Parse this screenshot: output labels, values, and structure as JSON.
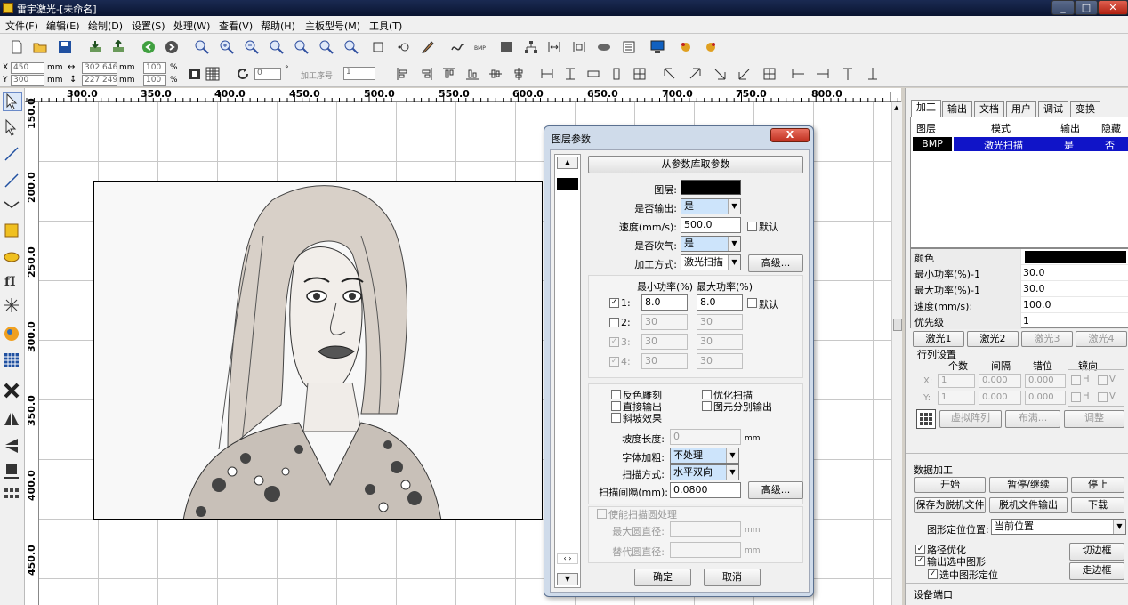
{
  "titlebar": {
    "title": "雷宇激光-[未命名]"
  },
  "menu": [
    "文件(F)",
    "编辑(E)",
    "绘制(D)",
    "设置(S)",
    "处理(W)",
    "查看(V)",
    "帮助(H)",
    "主板型号(M)",
    "工具(T)"
  ],
  "toolbar2": {
    "x_label": "X",
    "x_value": "450",
    "y_label": "Y",
    "y_value": "300",
    "mm": "mm",
    "width_value": "302.646",
    "height_value": "227.249",
    "scale_x": "100",
    "scale_y": "100",
    "percent": "%",
    "rotate_value": "0",
    "degree": "°",
    "order_label": "加工序号:",
    "order_value": "1"
  },
  "ruler": {
    "top_labels": [
      "300.0",
      "350.0",
      "400.0",
      "450.0",
      "500.0",
      "550.0",
      "600.0",
      "650.0",
      "700.0",
      "750.0",
      "800.0"
    ],
    "left_labels": [
      "150.0",
      "200.0",
      "250.0",
      "300.0",
      "350.0",
      "400.0",
      "450.0"
    ]
  },
  "dialog": {
    "title": "图层参数",
    "close": "X",
    "load_from_library": "从参数库取参数",
    "layer_label": "图层:",
    "output_label": "是否输出:",
    "output_value": "是",
    "speed_label": "速度(mm/s):",
    "speed_value": "500.0",
    "default_label": "默认",
    "blow_label": "是否吹气:",
    "blow_value": "是",
    "mode_label": "加工方式:",
    "mode_value": "激光扫描",
    "advanced": "高级...",
    "min_power_header": "最小功率(%)",
    "max_power_header": "最大功率(%)",
    "power_rows": [
      {
        "label": "1:",
        "min": "8.0",
        "max": "8.0"
      },
      {
        "label": "2:",
        "min": "30",
        "max": "30"
      },
      {
        "label": "3:",
        "min": "30",
        "max": "30"
      },
      {
        "label": "4:",
        "min": "30",
        "max": "30"
      }
    ],
    "invert_engrave": "反色雕刻",
    "optimize_scan": "优化扫描",
    "direct_output": "直接输出",
    "separate_output": "图元分别输出",
    "slope_effect": "斜坡效果",
    "slope_length_label": "坡度长度:",
    "slope_length_value": "0",
    "mm": "mm",
    "font_bold_label": "字体加粗:",
    "font_bold_value": "不处理",
    "scan_mode_label": "扫描方式:",
    "scan_mode_value": "水平双向",
    "scan_interval_label": "扫描间隔(mm):",
    "scan_interval_value": "0.0800",
    "circle_enable": "使能扫描圆处理",
    "max_circle_label": "最大圆直径:",
    "replace_circle_label": "替代圆直径:",
    "ok": "确定",
    "cancel": "取消"
  },
  "rpanel": {
    "tabs": [
      "加工",
      "输出",
      "文档",
      "用户",
      "调试",
      "变换"
    ],
    "layer_headers": [
      "图层",
      "模式",
      "输出",
      "隐藏"
    ],
    "layer_row": {
      "layer": "BMP",
      "mode": "激光扫描",
      "output": "是",
      "hidden": "否"
    },
    "props": [
      {
        "k": "颜色",
        "v": ""
      },
      {
        "k": "最小功率(%)-1",
        "v": "30.0"
      },
      {
        "k": "最大功率(%)-1",
        "v": "30.0"
      },
      {
        "k": "速度(mm/s):",
        "v": "100.0"
      },
      {
        "k": "优先级",
        "v": "1"
      }
    ],
    "laser_buttons": [
      "激光1",
      "激光2",
      "激光3",
      "激光4"
    ],
    "array_title": "行列设置",
    "array_headers": [
      "个数",
      "间隔",
      "错位",
      "镜向"
    ],
    "array_x": {
      "label": "X:",
      "count": "1",
      "gap": "0.000",
      "offset": "0.000"
    },
    "array_y": {
      "label": "Y:",
      "count": "1",
      "gap": "0.000",
      "offset": "0.000"
    },
    "mirror_h": "H",
    "mirror_v": "V",
    "virtual_array": "虚拟阵列",
    "layout": "布满...",
    "adjust": "调整",
    "data_title": "数据加工",
    "start": "开始",
    "pause": "暂停/继续",
    "stop": "停止",
    "save_offline": "保存为脱机文件",
    "offline_output": "脱机文件输出",
    "download": "下载",
    "position_label": "图形定位位置:",
    "position_value": "当前位置",
    "path_opt": "路径优化",
    "output_selected": "输出选中图形",
    "selected_position": "选中图形定位",
    "cut_frame": "切边框",
    "walk_frame": "走边框",
    "device_port": "设备端口"
  }
}
